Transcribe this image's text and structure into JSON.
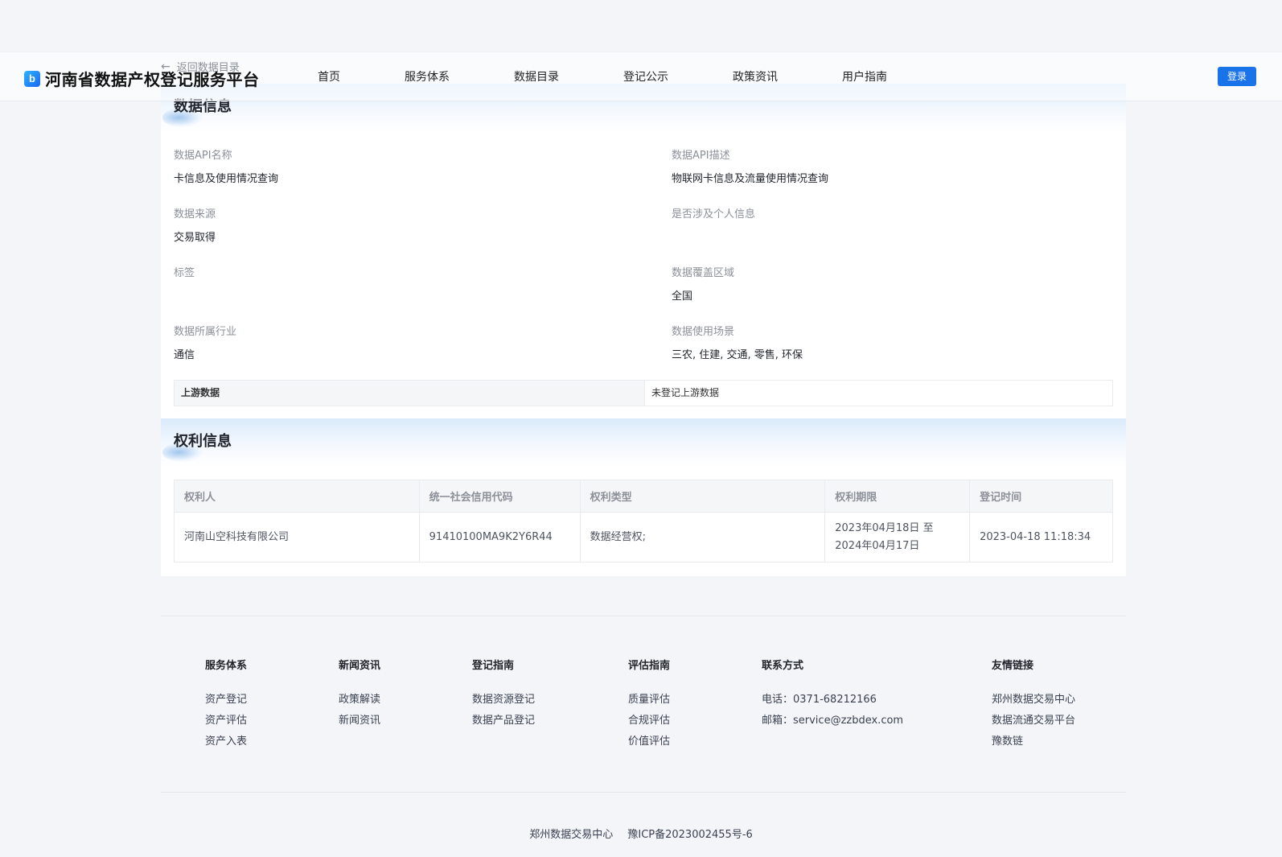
{
  "header": {
    "logo_glyph": "b",
    "site_title": "河南省数据产权登记服务平台",
    "back_link": "返回数据目录",
    "nav": [
      "首页",
      "服务体系",
      "数据目录",
      "登记公示",
      "政策资讯",
      "用户指南"
    ],
    "login_label": "登录"
  },
  "data_info": {
    "title": "数据信息",
    "fields": {
      "api_name": {
        "label": "数据API名称",
        "value": "卡信息及使用情况查询"
      },
      "api_desc": {
        "label": "数据API描述",
        "value": "物联网卡信息及流量使用情况查询"
      },
      "source": {
        "label": "数据来源",
        "value": "交易取得"
      },
      "personal_info": {
        "label": "是否涉及个人信息",
        "value": ""
      },
      "tags": {
        "label": "标签",
        "value": ""
      },
      "coverage": {
        "label": "数据覆盖区域",
        "value": "全国"
      },
      "industry": {
        "label": "数据所属行业",
        "value": "通信"
      },
      "scenarios": {
        "label": "数据使用场景",
        "value": "三农, 住建, 交通, 零售, 环保"
      }
    },
    "upstream": {
      "label": "上游数据",
      "value": "未登记上游数据"
    }
  },
  "rights_info": {
    "title": "权利信息",
    "columns": [
      "权利人",
      "统一社会信用代码",
      "权利类型",
      "权利期限",
      "登记时间"
    ],
    "rows": [
      {
        "holder": "河南山空科技有限公司",
        "credit_code": "91410100MA9K2Y6R44",
        "right_type": "数据经营权;",
        "period_start": "2023年04月18日 至",
        "period_end": "2024年04月17日",
        "registered_at": "2023-04-18 11:18:34"
      }
    ]
  },
  "footer": {
    "columns": [
      {
        "title": "服务体系",
        "links": [
          "资产登记",
          "资产评估",
          "资产入表"
        ]
      },
      {
        "title": "新闻资讯",
        "links": [
          "政策解读",
          "新闻资讯"
        ]
      },
      {
        "title": "登记指南",
        "links": [
          "数据资源登记",
          "数据产品登记"
        ]
      },
      {
        "title": "评估指南",
        "links": [
          "质量评估",
          "合规评估",
          "价值评估"
        ]
      }
    ],
    "contact": {
      "title": "联系方式",
      "phone": "电话：0371-68212166",
      "email": "邮箱：service@zzbdex.com"
    },
    "friends": {
      "title": "友情链接",
      "links": [
        "郑州数据交易中心",
        "数据流通交易平台",
        "豫数链"
      ]
    },
    "copyright_org": "郑州数据交易中心",
    "icp": "豫ICP备2023002455号-6"
  }
}
